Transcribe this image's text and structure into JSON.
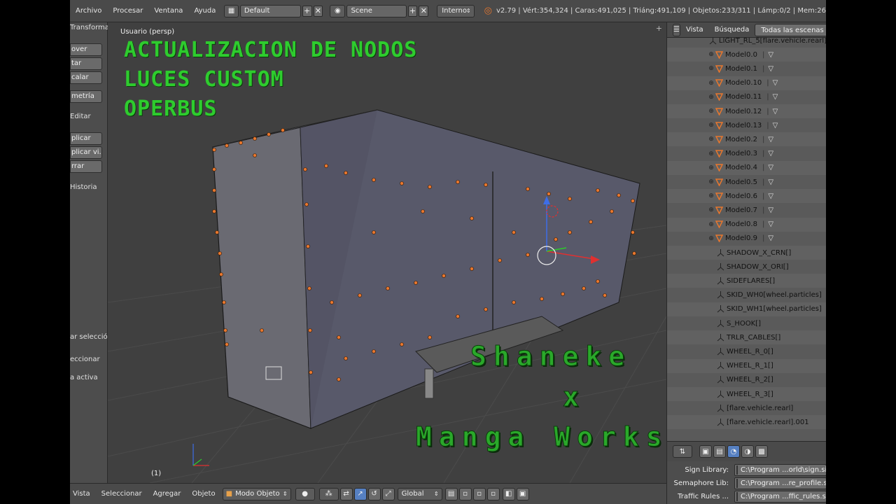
{
  "menu": {
    "file": "Archivo",
    "render": "Procesar",
    "window": "Ventana",
    "help": "Ayuda"
  },
  "header": {
    "layout_name": "Default",
    "scene_name": "Scene",
    "engine": "Interno",
    "stats": "v2.79 | Vért:354,324 | Caras:491,025 | Triáng:491,109 | Objetos:233/311 | Lámp:0/2 | Mem:26"
  },
  "toolshelf": {
    "transform_header": "Transforma",
    "move_btn": "over",
    "rotate_btn": "tar",
    "scale_btn": "calar",
    "geometry_btn": "metría",
    "edit_header": "Editar",
    "apply_btn": "plicar",
    "apply_view_btn": "plicar vi...",
    "delete_btn": "rrar",
    "history_header": "Historia",
    "select_header": "ar selección",
    "select_text": "eccionar",
    "active_text": "a activa"
  },
  "viewport": {
    "view_label": "Usuario (persp)",
    "frame": "(1)",
    "overlay_lines": [
      "ACTUALIZACION DE NODOS",
      "LUCES CUSTOM",
      "OPERBUS"
    ],
    "credit_lines": [
      "Shaneke",
      "x",
      "Manga Works"
    ]
  },
  "bottom_header": {
    "view": "Vista",
    "select": "Seleccionar",
    "add": "Agregar",
    "object": "Objeto",
    "mode": "Modo Objeto",
    "orientation": "Global"
  },
  "outliner": {
    "tabs": [
      "Vista",
      "Búsqueda",
      "Todas las escenas"
    ],
    "rows": [
      {
        "label": "LIGHT_RL_5[flare.vehicle.rearl]",
        "kind": "empty"
      },
      {
        "label": "Model0.0",
        "kind": "mesh"
      },
      {
        "label": "Model0.1",
        "kind": "mesh"
      },
      {
        "label": "Model0.10",
        "kind": "mesh"
      },
      {
        "label": "Model0.11",
        "kind": "mesh"
      },
      {
        "label": "Model0.12",
        "kind": "mesh"
      },
      {
        "label": "Model0.13",
        "kind": "mesh"
      },
      {
        "label": "Model0.2",
        "kind": "mesh"
      },
      {
        "label": "Model0.3",
        "kind": "mesh"
      },
      {
        "label": "Model0.4",
        "kind": "mesh"
      },
      {
        "label": "Model0.5",
        "kind": "mesh"
      },
      {
        "label": "Model0.6",
        "kind": "mesh"
      },
      {
        "label": "Model0.7",
        "kind": "mesh"
      },
      {
        "label": "Model0.8",
        "kind": "mesh"
      },
      {
        "label": "Model0.9",
        "kind": "mesh"
      },
      {
        "label": "SHADOW_X_CRN[]",
        "kind": "empty"
      },
      {
        "label": "SHADOW_X_ORI[]",
        "kind": "empty"
      },
      {
        "label": "SIDEFLARES[]",
        "kind": "empty"
      },
      {
        "label": "SKID_WH0[wheel.particles]",
        "kind": "empty"
      },
      {
        "label": "SKID_WH1[wheel.particles]",
        "kind": "empty"
      },
      {
        "label": "S_HOOK[]",
        "kind": "empty"
      },
      {
        "label": "TRLR_CABLES[]",
        "kind": "empty"
      },
      {
        "label": "WHEEL_R_0[]",
        "kind": "empty"
      },
      {
        "label": "WHEEL_R_1[]",
        "kind": "empty"
      },
      {
        "label": "WHEEL_R_2[]",
        "kind": "empty"
      },
      {
        "label": "WHEEL_R_3[]",
        "kind": "empty"
      },
      {
        "label": "[flare.vehicle.rearl]",
        "kind": "empty"
      },
      {
        "label": "[flare.vehicle.rearl].001",
        "kind": "empty"
      }
    ]
  },
  "properties": {
    "rows": [
      {
        "label": "Sign Library:",
        "value": "C:\\Program ...orld\\sign.sii"
      },
      {
        "label": "Semaphore Lib:",
        "value": "C:\\Program ...re_profile.sii"
      },
      {
        "label": "Traffic Rules ...",
        "value": "C:\\Program ...ffic_rules.sii"
      }
    ]
  },
  "colors": {
    "overlay_green": "#2ecc2e",
    "vertex_orange": "#e8772e",
    "active_blue": "#5680c2"
  }
}
